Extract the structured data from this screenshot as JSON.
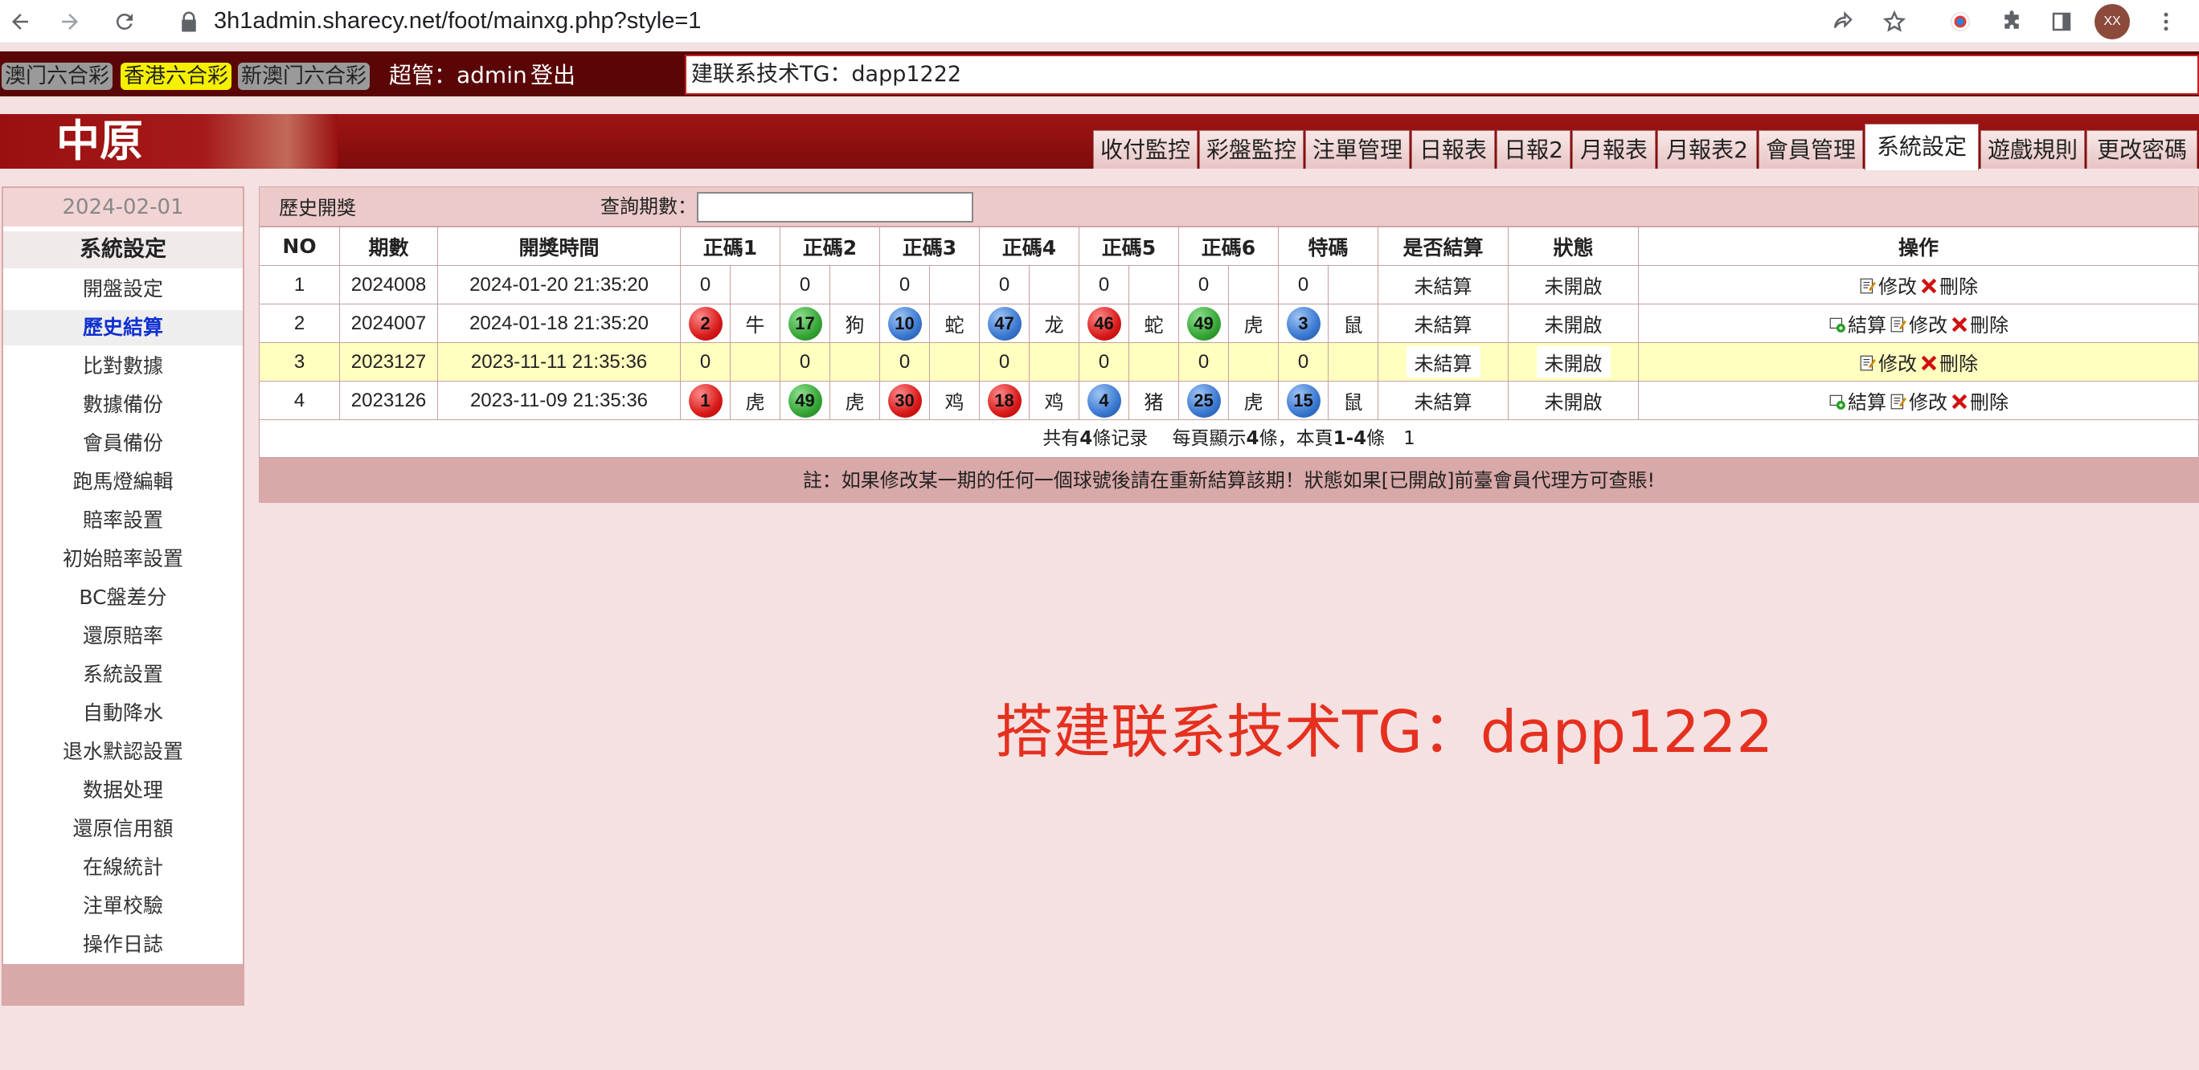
{
  "browser": {
    "url": "3h1admin.sharecy.net/foot/mainxg.php?style=1",
    "avatar": "XX"
  },
  "topbar": {
    "lottery_tabs": [
      "澳门六合彩",
      "香港六合彩",
      "新澳门六合彩"
    ],
    "active_lottery": "香港六合彩",
    "admin_label": "超管：admin",
    "logout": "登出",
    "marquee": "建联系技术TG：dapp1222"
  },
  "header": {
    "logo": "中原",
    "tabs": [
      "收付監控",
      "彩盤監控",
      "注單管理",
      "日報表",
      "日報2",
      "月報表",
      "月報表2",
      "會員管理",
      "系統設定",
      "遊戲規則",
      "更改密碼"
    ],
    "active_tab": "系統設定"
  },
  "sidebar": {
    "date": "2024-02-01",
    "title": "系統設定",
    "items": [
      "開盤設定",
      "歷史結算",
      "比對數據",
      "數據備份",
      "會員備份",
      "跑馬燈編輯",
      "賠率設置",
      "初始賠率設置",
      "BC盤差分",
      "還原賠率",
      "系統設置",
      "自動降水",
      "退水默認設置",
      "数据处理",
      "還原信用額",
      "在線統計",
      "注單校驗",
      "操作日誌"
    ],
    "active_item": "歷史結算"
  },
  "search": {
    "title": "歷史開獎",
    "label": "查詢期數：",
    "value": ""
  },
  "table": {
    "headers": [
      "NO",
      "期數",
      "開獎時間",
      "正碼1",
      "正碼2",
      "正碼3",
      "正碼4",
      "正碼5",
      "正碼6",
      "特碼",
      "是否結算",
      "狀態",
      "操作"
    ],
    "rows": [
      {
        "no": "1",
        "period": "2024008",
        "time": "2024-01-20 21:35:20",
        "balls": [
          {
            "num": "0",
            "color": "",
            "zodiac": ""
          },
          {
            "num": "0",
            "color": "",
            "zodiac": ""
          },
          {
            "num": "0",
            "color": "",
            "zodiac": ""
          },
          {
            "num": "0",
            "color": "",
            "zodiac": ""
          },
          {
            "num": "0",
            "color": "",
            "zodiac": ""
          },
          {
            "num": "0",
            "color": "",
            "zodiac": ""
          },
          {
            "num": "0",
            "color": "",
            "zodiac": ""
          }
        ],
        "settled": "未結算",
        "status": "未開啟",
        "ops": [
          "修改",
          "刪除"
        ]
      },
      {
        "no": "2",
        "period": "2024007",
        "time": "2024-01-18 21:35:20",
        "balls": [
          {
            "num": "2",
            "color": "red",
            "zodiac": "牛"
          },
          {
            "num": "17",
            "color": "green",
            "zodiac": "狗"
          },
          {
            "num": "10",
            "color": "blue",
            "zodiac": "蛇"
          },
          {
            "num": "47",
            "color": "blue",
            "zodiac": "龙"
          },
          {
            "num": "46",
            "color": "red",
            "zodiac": "蛇"
          },
          {
            "num": "49",
            "color": "green",
            "zodiac": "虎"
          },
          {
            "num": "3",
            "color": "blue",
            "zodiac": "鼠"
          }
        ],
        "settled": "未結算",
        "status": "未開啟",
        "ops": [
          "結算",
          "修改",
          "刪除"
        ]
      },
      {
        "no": "3",
        "period": "2023127",
        "time": "2023-11-11 21:35:36",
        "highlight": true,
        "balls": [
          {
            "num": "0",
            "color": "",
            "zodiac": ""
          },
          {
            "num": "0",
            "color": "",
            "zodiac": ""
          },
          {
            "num": "0",
            "color": "",
            "zodiac": ""
          },
          {
            "num": "0",
            "color": "",
            "zodiac": ""
          },
          {
            "num": "0",
            "color": "",
            "zodiac": ""
          },
          {
            "num": "0",
            "color": "",
            "zodiac": ""
          },
          {
            "num": "0",
            "color": "",
            "zodiac": ""
          }
        ],
        "settled": "未結算",
        "status": "未開啟",
        "ops": [
          "修改",
          "刪除"
        ]
      },
      {
        "no": "4",
        "period": "2023126",
        "time": "2023-11-09 21:35:36",
        "balls": [
          {
            "num": "1",
            "color": "red",
            "zodiac": "虎"
          },
          {
            "num": "49",
            "color": "green",
            "zodiac": "虎"
          },
          {
            "num": "30",
            "color": "red",
            "zodiac": "鸡"
          },
          {
            "num": "18",
            "color": "red",
            "zodiac": "鸡"
          },
          {
            "num": "4",
            "color": "blue",
            "zodiac": "猪"
          },
          {
            "num": "25",
            "color": "blue",
            "zodiac": "虎"
          },
          {
            "num": "15",
            "color": "blue",
            "zodiac": "鼠"
          }
        ],
        "settled": "未結算",
        "status": "未開啟",
        "ops": [
          "結算",
          "修改",
          "刪除"
        ]
      }
    ]
  },
  "pager": {
    "prefix": "共有",
    "total": "4",
    "mid1": "條记录　 每頁顯示",
    "per_page": "4",
    "mid2": "條，本頁",
    "range": "1-4",
    "mid3": "條　",
    "page": "1"
  },
  "note": "註：如果修改某一期的任何一個球號後請在重新結算該期！狀態如果[已開啟]前臺會員代理方可查賬!",
  "watermark": "搭建联系技术TG：dapp1222",
  "colors": {
    "ball_red": "#d81a1a",
    "ball_green": "#35a535",
    "ball_blue": "#3a78d0",
    "header_red": "#a11414",
    "status_red": "#e01010",
    "link_blue": "#1020c0"
  }
}
